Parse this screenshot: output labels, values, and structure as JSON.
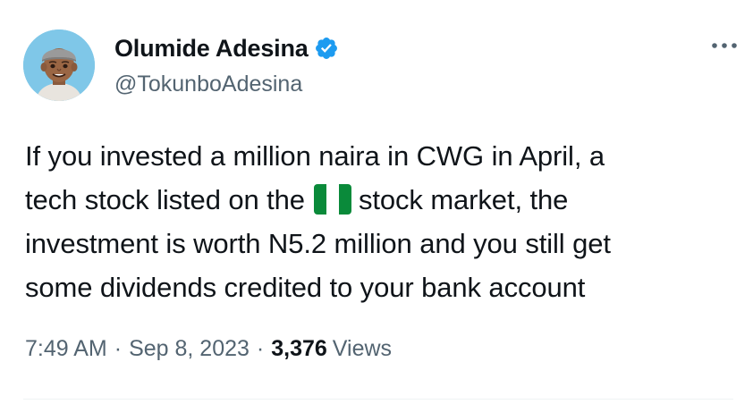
{
  "author": {
    "display_name": "Olumide Adesina",
    "handle": "@TokunboAdesina",
    "verified_icon": "verified-badge-icon",
    "avatar_icon": "memoji-avatar-icon"
  },
  "actions": {
    "more_icon": "more-dots-icon"
  },
  "tweet": {
    "line1": "If you invested a million naira in CWG in April, a",
    "line2_before_flag": "tech stock listed on the",
    "flag_icon": "nigeria-flag-icon",
    "line2_after_flag": "stock market, the",
    "line3": "investment is worth N5.2 million and you still get",
    "line4": "some dividends credited to your bank account"
  },
  "meta": {
    "time": "7:49 AM",
    "separator": "·",
    "date": "Sep 8, 2023",
    "views_count": "3,376",
    "views_label": "Views"
  },
  "colors": {
    "text_primary": "#0f1419",
    "text_secondary": "#536471",
    "verified_blue": "#1d9bf0",
    "avatar_bg": "#7fc7e8",
    "flag_green": "#0a8a3a",
    "divider": "#eff3f4"
  }
}
